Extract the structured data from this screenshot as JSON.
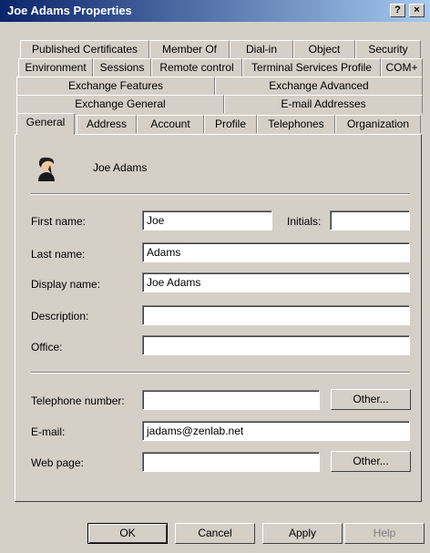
{
  "window": {
    "title": "Joe Adams Properties",
    "help_btn": "?",
    "close_btn": "×"
  },
  "tabs": {
    "row1": [
      "Published Certificates",
      "Member Of",
      "Dial-in",
      "Object",
      "Security"
    ],
    "row2": [
      "Environment",
      "Sessions",
      "Remote control",
      "Terminal Services Profile",
      "COM+"
    ],
    "row3": [
      "Exchange Features",
      "Exchange Advanced"
    ],
    "row4": [
      "Exchange General",
      "E-mail Addresses"
    ],
    "row5": [
      "General",
      "Address",
      "Account",
      "Profile",
      "Telephones",
      "Organization"
    ]
  },
  "general": {
    "header_name": "Joe Adams",
    "fields": {
      "first_name_label": "First name:",
      "first_name": "Joe",
      "initials_label": "Initials:",
      "initials": "",
      "last_name_label": "Last name:",
      "last_name": "Adams",
      "display_name_label": "Display name:",
      "display_name": "Joe Adams",
      "description_label": "Description:",
      "description": "",
      "office_label": "Office:",
      "office": "",
      "telephone_label": "Telephone number:",
      "telephone": "",
      "email_label": "E-mail:",
      "email": "jadams@zenlab.net",
      "webpage_label": "Web page:",
      "webpage": ""
    },
    "other_phone_btn": "Other...",
    "other_web_btn": "Other..."
  },
  "footer": {
    "ok": "OK",
    "cancel": "Cancel",
    "apply": "Apply",
    "help": "Help"
  }
}
